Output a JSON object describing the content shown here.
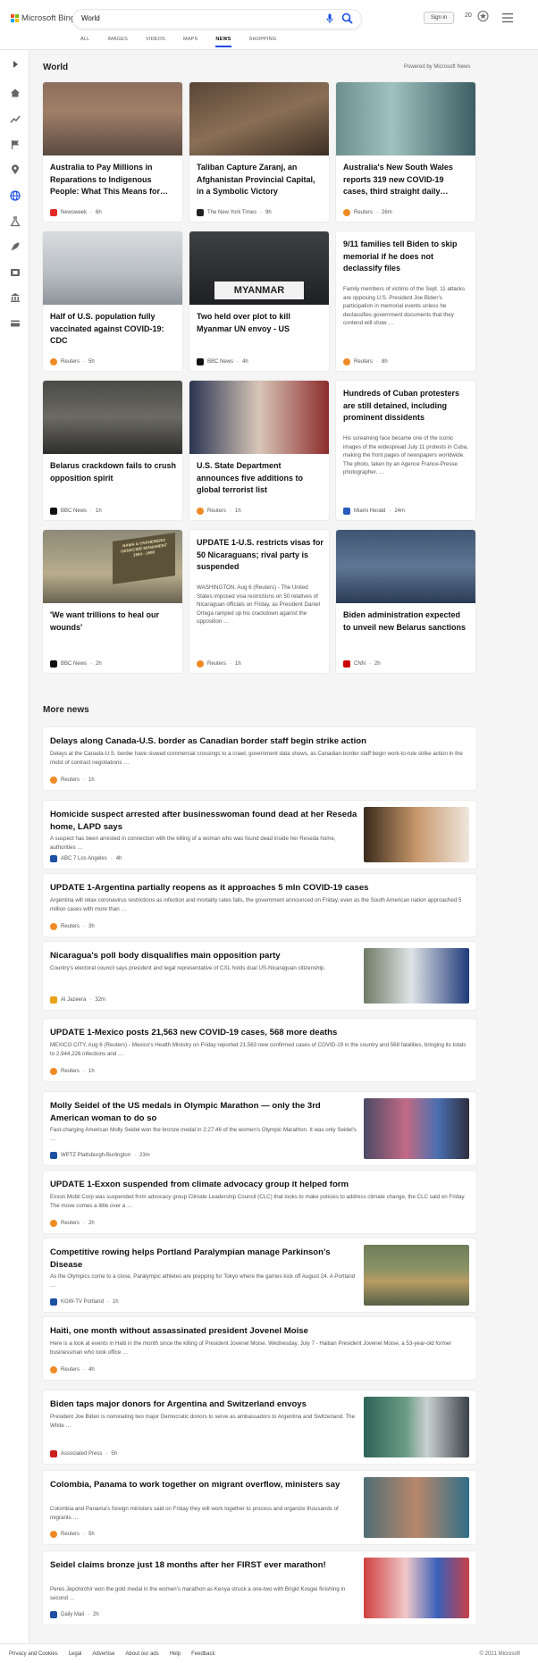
{
  "brand": {
    "name": "Microsoft Bing"
  },
  "search": {
    "query": "World"
  },
  "header": {
    "sign_in": "Sign in",
    "rewards": "20"
  },
  "tabs": [
    {
      "label": "ALL",
      "active": false
    },
    {
      "label": "IMAGES",
      "active": false
    },
    {
      "label": "VIDEOS",
      "active": false
    },
    {
      "label": "MAPS",
      "active": false
    },
    {
      "label": "NEWS",
      "active": true
    },
    {
      "label": "SHOPPING",
      "active": false
    }
  ],
  "sidebar": {
    "icons": [
      "chevron-right-icon",
      "home-icon",
      "trending-icon",
      "flag-icon",
      "location-pin-icon",
      "globe-icon",
      "science-icon",
      "rocket-icon",
      "film-icon",
      "bank-icon",
      "card-icon"
    ]
  },
  "section": {
    "title": "World",
    "powered": "Powered by Microsoft News"
  },
  "cards": [
    {
      "title": "Australia to Pay Millions in Reparations to Indigenous People: What This Means for…",
      "source": "Newsweek",
      "age": "6h",
      "logo_color": "#e22828",
      "img": "photo"
    },
    {
      "title": "Taliban Capture Zaranj, an Afghanistan Provincial Capital, in a Symbolic Victory",
      "source": "The New York Times",
      "age": "9h",
      "logo_color": "#222222",
      "img": "photo"
    },
    {
      "title": "Australia's New South Wales reports 319 new COVID-19 cases, third straight daily…",
      "source": "Reuters",
      "age": "26m",
      "logo_color": "#f08a24",
      "img": "photo"
    },
    {
      "title": "Half of U.S. population fully vaccinated against COVID-19: CDC",
      "source": "Reuters",
      "age": "5h",
      "logo_color": "#f08a24",
      "img": "photo"
    },
    {
      "title": "Two held over plot to kill Myanmar UN envoy - US",
      "source": "BBC News",
      "age": "4h",
      "logo_color": "#111111",
      "img": "photo",
      "sign": "MYANMAR"
    },
    {
      "title": "9/11 families tell Biden to skip memorial if he does not declassify files",
      "snippet": "Family members of victims of the Sept. 11 attacks are opposing U.S. President Joe Biden's participation in memorial events unless he declassifies government documents that they contend will show …",
      "source": "Reuters",
      "age": "8h",
      "logo_color": "#f08a24"
    },
    {
      "title": "Belarus crackdown fails to crush opposition spirit",
      "source": "BBC News",
      "age": "1h",
      "logo_color": "#111111",
      "img": "photo"
    },
    {
      "title": "U.S. State Department announces five additions to global terrorist list",
      "source": "Reuters",
      "age": "1h",
      "logo_color": "#f08a24",
      "img": "photo"
    },
    {
      "title": "Hundreds of Cuban protesters are still detained, including prominent dissidents",
      "snippet": "His screaming face became one of the iconic images of the widespread July 11 protests in Cuba, making the front pages of newspapers worldwide. The photo, taken by an Agence France-Presse photographer, …",
      "source": "Miami Herald",
      "age": "24m",
      "logo_color": "#2a5bbd"
    },
    {
      "title": "'We want trillions to heal our wounds'",
      "source": "BBC News",
      "age": "2h",
      "logo_color": "#111111",
      "img": "photo",
      "plaque": [
        "NAMA & OVAHERERO",
        "GENOCIDE MONUMENT",
        "1904 - 1908"
      ]
    },
    {
      "title": "UPDATE 1-U.S. restricts visas for 50 Nicaraguans; rival party is suspended",
      "snippet": "WASHINGTON, Aug 6 (Reuters) - The United States imposed visa restrictions on 50 relatives of Nicaraguan officials on Friday, as President Daniel Ortega ramped up his crackdown against the opposition …",
      "source": "Reuters",
      "age": "1h",
      "logo_color": "#f08a24"
    },
    {
      "title": "Biden administration expected to unveil new Belarus sanctions",
      "source": "CNN",
      "age": "2h",
      "logo_color": "#cc0000",
      "img": "photo"
    }
  ],
  "more_title": "More news",
  "more": [
    {
      "title": "Delays along Canada-U.S. border as Canadian border staff begin strike action",
      "snippet": "Delays at the Canada-U.S. border have slowed commercial crossings to a crawl, government data shows, as Canadian border staff begin work-to-rule strike action in the midst of contract negotiations …",
      "source": "Reuters",
      "age": "1h",
      "logo_color": "#f08a24",
      "thumb": false
    },
    {
      "title": "Homicide suspect arrested after businesswoman found dead at her Reseda home, LAPD says",
      "snippet": "A suspect has been arrested in connection with the killing of a woman who was found dead inside her Reseda home, authorities …",
      "source": "ABC 7 Los Angeles",
      "age": "4h",
      "logo_color": "#1d4fa3",
      "thumb": true
    },
    {
      "title": "UPDATE 1-Argentina partially reopens as it approaches 5 mln COVID-19 cases",
      "snippet": "Argentina will relax coronavirus restrictions as infection and mortality rates falls, the government announced on Friday, even as the South American nation approached 5 million cases with more than …",
      "source": "Reuters",
      "age": "3h",
      "logo_color": "#f08a24",
      "thumb": false
    },
    {
      "title": "Nicaragua's poll body disqualifies main opposition party",
      "snippet": "Country's electoral council says president and legal representative of CXL holds dual US-Nicaraguan citizenship.",
      "source": "Al Jazeera",
      "age": "32m",
      "logo_color": "#e8a317",
      "thumb": true
    },
    {
      "title": "UPDATE 1-Mexico posts 21,563 new COVID-19 cases, 568 more deaths",
      "snippet": "MEXICO CITY, Aug 6 (Reuters) - Mexico's Health Ministry on Friday reported 21,563 new confirmed cases of COVID-19 in the country and 568 fatalities, bringing its totals to 2,944,226 infections and …",
      "source": "Reuters",
      "age": "1h",
      "logo_color": "#f08a24",
      "thumb": false
    },
    {
      "title": "Molly Seidel of the US medals in Olympic Marathon — only the 3rd American woman to do so",
      "snippet": "Fast-charging American Molly Seidel won the bronze medal in 2:27:46 of the women's Olympic Marathon. It was only Seidel's …",
      "source": "WPTZ Plattsburgh-Burlington",
      "age": "23m",
      "logo_color": "#1d4fa3",
      "thumb": true
    },
    {
      "title": "UPDATE 1-Exxon suspended from climate advocacy group it helped form",
      "snippet": "Exxon Mobil Corp was suspended from advocacy group Climate Leadership Council (CLC) that looks to make policies to address climate change, the CLC said on Friday. The move comes a little over a …",
      "source": "Reuters",
      "age": "2h",
      "logo_color": "#f08a24",
      "thumb": false
    },
    {
      "title": "Competitive rowing helps Portland Paralympian manage Parkinson's Disease",
      "snippet": "As the Olympics come to a close, Paralympic athletes are prepping for Tokyo where the games kick off August 24. A Portland …",
      "source": "KGW-TV Portland",
      "age": "1h",
      "logo_color": "#1d4fa3",
      "thumb": true
    },
    {
      "title": "Haiti, one month without assassinated president Jovenel Moise",
      "snippet": "Here is a look at events in Haiti in the month since the killing of President Jovenel Moise. Wednesday, July 7 - Haitian President Jovenel Moise, a 53-year-old former businessman who took office …",
      "source": "Reuters",
      "age": "4h",
      "logo_color": "#f08a24",
      "thumb": false
    },
    {
      "title": "Biden taps major donors for Argentina and Switzerland envoys",
      "snippet": "President Joe Biden is nominating two major Democratic donors to serve as ambassadors to Argentina and Switzerland. The White …",
      "source": "Associated Press",
      "age": "5h",
      "logo_color": "#cc1f1f",
      "thumb": true
    },
    {
      "title": "Colombia, Panama to work together on migrant overflow, ministers say",
      "snippet": "Colombia and Panama's foreign ministers said on Friday they will work together to process and organize thousands of migrants …",
      "source": "Reuters",
      "age": "5h",
      "logo_color": "#f08a24",
      "thumb": true
    },
    {
      "title": "Seidel claims bronze just 18 months after her FIRST ever marathon!",
      "snippet": "Peres Jepchirchir won the gold medal in the women's marathon as Kenya struck a one-two with Brigid Kosgei finishing in second …",
      "source": "Daily Mail",
      "age": "2h",
      "logo_color": "#1d4fa3",
      "thumb": true
    }
  ],
  "footer": {
    "links": [
      "Privacy and Cookies",
      "Legal",
      "Advertise",
      "About our ads",
      "Help",
      "Feedback"
    ],
    "copyright": "© 2021 Microsoft"
  }
}
